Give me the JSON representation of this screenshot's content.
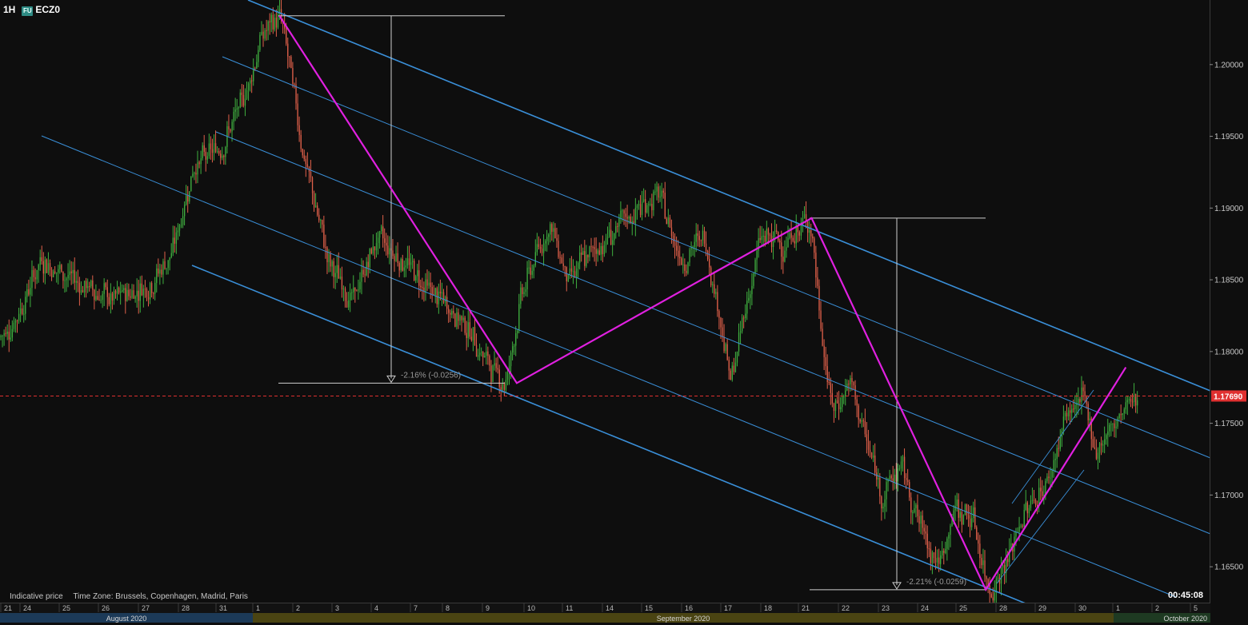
{
  "header": {
    "timeframe": "1H",
    "badge": "FU",
    "symbol": "ECZ0"
  },
  "footer": {
    "note": "Indicative price",
    "timezone": "Time Zone: Brussels, Copenhagen, Madrid, Paris",
    "countdown": "00:45:08"
  },
  "chart_data": {
    "type": "candlestick",
    "y_axis": {
      "range": [
        1.1625,
        1.2045
      ],
      "ticks": [
        "1.16500",
        "1.17000",
        "1.17500",
        "1.18000",
        "1.18500",
        "1.19000",
        "1.19500",
        "1.20000"
      ],
      "tick_values": [
        1.165,
        1.17,
        1.175,
        1.18,
        1.185,
        1.19,
        1.195,
        1.2
      ]
    },
    "current_price": {
      "label": "1.17690",
      "value": 1.1769,
      "color": "#e03030"
    },
    "x_axis": {
      "day_labels": [
        "21",
        "24",
        "25",
        "26",
        "27",
        "28",
        "31",
        "1",
        "2",
        "3",
        "4",
        "7",
        "8",
        "9",
        "10",
        "11",
        "14",
        "15",
        "16",
        "17",
        "18",
        "21",
        "22",
        "23",
        "24",
        "25",
        "28",
        "29",
        "30",
        "1",
        "2",
        "5"
      ],
      "months": [
        {
          "label": "August 2020",
          "color": "#1c3a58"
        },
        {
          "label": "September 2020",
          "color": "#4a4412"
        },
        {
          "label": "October 2020",
          "color": "#1e3a22"
        }
      ]
    },
    "series": [
      {
        "type": "zigzag",
        "color": "#e020e0",
        "points": [
          {
            "date": "2020-09-01 14:00",
            "price": 1.2034
          },
          {
            "date": "2020-09-09 18:00",
            "price": 1.1778
          },
          {
            "date": "2020-09-21 06:00",
            "price": 1.1893
          },
          {
            "date": "2020-09-25 16:00",
            "price": 1.1634
          },
          {
            "date": "2020-10-01 06:00",
            "price": 1.1789
          }
        ]
      }
    ],
    "measurements": [
      {
        "label": "-2.16% (-0.0256)",
        "from": 1.2034,
        "to": 1.1778
      },
      {
        "label": "-2.21% (-0.0259)",
        "from": 1.1893,
        "to": 1.1634
      }
    ],
    "channel_color": "#3a8fd8",
    "candle_up_color": "#3fae3f",
    "candle_down_color": "#e0604a"
  }
}
